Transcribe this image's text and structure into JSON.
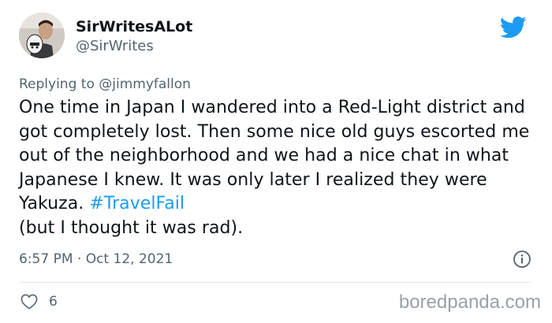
{
  "user": {
    "display_name": "SirWritesALot",
    "handle": "@SirWrites"
  },
  "reply": {
    "prefix": "Replying to ",
    "mention": "@jimmyfallon"
  },
  "tweet": {
    "text": "One time in Japan I wandered into a Red-Light district and got completely lost. Then some nice old guys escorted me out of the neighborhood and we had a nice chat in what Japanese I knew. It was only later I realized they were Yakuza. ",
    "hashtag": "#TravelFail",
    "suffix": " (but I thought it was rad).",
    "timestamp": "6:57 PM · Oct 12, 2021"
  },
  "actions": {
    "likes": "6"
  },
  "watermark": "boredpanda.com",
  "icons": {
    "logo": "twitter-bird-icon",
    "info": "info-icon",
    "like": "heart-icon"
  },
  "colors": {
    "accent": "#1d9bf0",
    "secondary_text": "#536471",
    "primary_text": "#0f1419"
  }
}
